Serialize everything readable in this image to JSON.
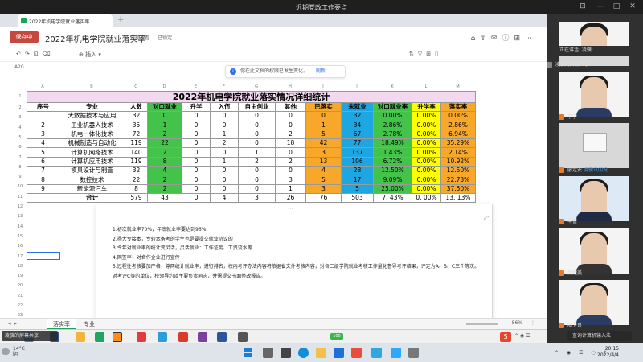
{
  "meeting": {
    "title": "近期党政工作要点",
    "speaking": "正在讲话: 凌骥;",
    "share_toast": "凌骥的屏幕共享",
    "speaker_toast": "查询计算机输入法"
  },
  "browser": {
    "tab_title": "2022年机电学院就业落实率"
  },
  "doc": {
    "sharing_label": "保存中",
    "title": "2022年机电学院就业落实率",
    "permission": "只能查看",
    "lock_label": "已锁定",
    "insert_label": "插入",
    "cell_ref": "A20",
    "notice": "你在此文档的权限已发生变化。",
    "notice_link": "刷新"
  },
  "sheet": {
    "col_letters": [
      "A",
      "B",
      "C",
      "D",
      "E",
      "F",
      "G",
      "H",
      "I",
      "J",
      "K",
      "L",
      "M"
    ],
    "title": "2022年机电学院就业落实情况详细统计",
    "headers": [
      "序号",
      "专业",
      "人数",
      "对口就业",
      "升学",
      "入伍",
      "自主创业",
      "其他",
      "已落实",
      "未就业",
      "对口就业率",
      "升学率",
      "落实率"
    ],
    "rows": [
      [
        "1",
        "大数据技术与应用",
        "32",
        "0",
        "0",
        "0",
        "0",
        "0",
        "0",
        "32",
        "0.00%",
        "0.00%",
        "0.00%"
      ],
      [
        "2",
        "工业机器人技术",
        "35",
        "1",
        "0",
        "0",
        "0",
        "0",
        "1",
        "34",
        "2.86%",
        "0.00%",
        "2.86%"
      ],
      [
        "3",
        "机电一体化技术",
        "72",
        "2",
        "0",
        "1",
        "0",
        "2",
        "5",
        "67",
        "2.78%",
        "0.00%",
        "6.94%"
      ],
      [
        "4",
        "机械制造与自动化",
        "119",
        "22",
        "0",
        "2",
        "0",
        "18",
        "42",
        "77",
        "18.49%",
        "0.00%",
        "35.29%"
      ],
      [
        "5",
        "计算机网络技术",
        "140",
        "2",
        "0",
        "0",
        "1",
        "0",
        "3",
        "137",
        "1.43%",
        "0.00%",
        "2.14%"
      ],
      [
        "6",
        "计算机应用技术",
        "119",
        "8",
        "0",
        "1",
        "2",
        "2",
        "13",
        "106",
        "6.72%",
        "0.00%",
        "10.92%"
      ],
      [
        "7",
        "模具设计与制造",
        "32",
        "4",
        "0",
        "0",
        "0",
        "0",
        "4",
        "28",
        "12.50%",
        "0.00%",
        "12.50%"
      ],
      [
        "8",
        "数控技术",
        "22",
        "2",
        "0",
        "0",
        "0",
        "3",
        "5",
        "17",
        "9.09%",
        "0.00%",
        "22.73%"
      ],
      [
        "9",
        "新能源汽车",
        "8",
        "2",
        "0",
        "0",
        "0",
        "1",
        "3",
        "5",
        "25.00%",
        "0.00%",
        "37.50%"
      ]
    ],
    "total": [
      "",
      "合计",
      "579",
      "43",
      "0",
      "4",
      "3",
      "26",
      "76",
      "503",
      "7. 43%",
      "0. 00%",
      "13. 13%"
    ],
    "tab1": "落实率",
    "tab2": "专业",
    "zoom": "86%",
    "zoom_label": "⋮"
  },
  "notes": [
    "1.初次就业率70%，年底就业率要达到96%",
    "2.扬大专接本，专转本备考的学生也是要提交就业协议的",
    "3.今年对就业率的统计变灵活，灵活就业：工作证明、工资流水等",
    "4.网签率：对合作企业进行宣传",
    "5.过程性考核要加严格，尊两统计就业率，进行排名，校内考评办法内容将依据省文件考核内容，对各二级学院就业考核工作量化督导考评结果，评定为A、B、C三个等次。对考评C等的单位，校领导约谈主要负责同志，并需提交书面整改报告。"
  ],
  "participants": [
    {
      "name": "凌骥的屏幕共享"
    },
    {
      "name": "李宁"
    },
    {
      "name": "廖定安",
      "extra": "凌骥讯问说"
    },
    {
      "name": "羊蕾"
    },
    {
      "name": "颜婕美"
    },
    {
      "name": "陆卫良"
    }
  ],
  "system": {
    "temp": "14°C",
    "weather": "阴",
    "time": "20:15",
    "date": "2022/4/4",
    "inner_pct": "100"
  },
  "colors": {
    "green": "#44c34a",
    "orange": "#f7a82b",
    "blue": "#1ea6e2",
    "yellow": "#ffff00",
    "title_bg": "#f3d9f0"
  }
}
